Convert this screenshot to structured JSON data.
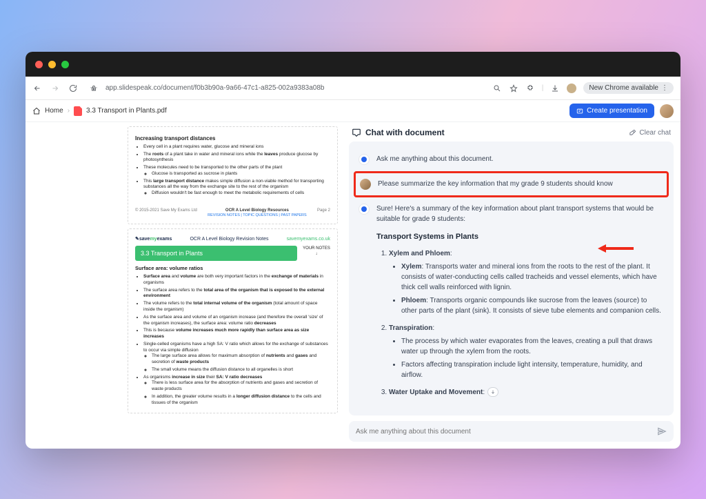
{
  "url": "app.slidespeak.co/document/f0b3b90a-9a66-47c1-a825-002a9383a08b",
  "chrome_badge": "New Chrome available",
  "breadcrumb": {
    "home": "Home",
    "file": "3.3 Transport in Plants.pdf"
  },
  "toolbar": {
    "create": "Create presentation"
  },
  "doc": {
    "page1": {
      "h1": "Increasing transport distances",
      "li1": "Every cell in a plant requires water, glucose and mineral ions",
      "li2a": "The ",
      "li2b": "roots",
      "li2c": " of a plant take in water and mineral ions while the ",
      "li2d": "leaves",
      "li2e": " produce glucose by photosynthesis",
      "li3": "These molecules need to be transported to the other parts of the plant",
      "li3a": "Glucose is transported as sucrose in plants",
      "li4a": "This ",
      "li4b": "large transport distance",
      "li4c": " makes simple diffusion a non-viable method for transporting substances all the way from the exchange site to the rest of the organism",
      "li4s": "Diffusion wouldn't be fast enough to meet the metabolic requirements of cells",
      "footer_left": "© 2015-2021 Save My Exams Ltd",
      "footer_center_title": "OCR A Level Biology Resources",
      "footer_center_links": "REVISION NOTES  |  TOPIC QUESTIONS  |  PAST PAPERS",
      "footer_right": "Page 2"
    },
    "page2": {
      "site_a": "save",
      "site_b": "my",
      "site_c": "exams",
      "site_right": "savemyexams.co.uk",
      "head_title": "OCR A Level Biology Revision Notes",
      "banner": "3.3 Transport in Plants",
      "notes_label": "YOUR NOTES",
      "h_sav": "Surface area: volume ratios",
      "b1a": "Surface area",
      "b1b": " and ",
      "b1c": "volume",
      "b1d": " are both very important factors in the ",
      "b1e": "exchange of materials",
      "b1f": " in organisms",
      "b2a": "The surface area refers to the ",
      "b2b": "total area of the organism that is exposed to the external environment",
      "b3a": "The volume refers to the ",
      "b3b": "total internal volume of the organism",
      "b3c": " (total amount of space inside the organism)",
      "b4": "As the surface area and volume of an organism increase (and therefore the overall 'size' of the organism increases), the surface area: volume ratio ",
      "b4b": "decreases",
      "b5a": "This is because ",
      "b5b": "volume increases much more rapidly than surface area as size increases",
      "b6": "Single-celled organisms have a high SA: V ratio which allows for the exchange of substances to occur via simple diffusion",
      "b6a_a": "The large surface area allows for maximum absorption of ",
      "b6a_b": "nutrients",
      "b6a_c": " and ",
      "b6a_d": "gases",
      "b6a_e": " and secretion of ",
      "b6a_f": "waste products",
      "b6b": "The small volume means the diffusion distance to all organelles is short",
      "b7a": "As organisms ",
      "b7b": "increase in size",
      "b7c": " their ",
      "b7d": "SA: V ratio decreases",
      "b7s1": "There is less surface area for the absorption of nutrients and gases and secretion of waste products",
      "b7s2a": "In addition, the greater volume results in a ",
      "b7s2b": "longer diffusion distance",
      "b7s2c": " to the cells and tissues of the organism"
    }
  },
  "chat": {
    "title": "Chat with document",
    "clear": "Clear chat",
    "m1": "Ask me anything about this document.",
    "m2": "Please summarize the key information that my grade 9 students should know",
    "m3_intro": "Sure! Here's a summary of the key information about plant transport systems that would be suitable for grade 9 students:",
    "h": "Transport Systems in Plants",
    "li1_label": "Xylem and Phloem",
    "li1_a_b": "Xylem",
    "li1_a": ": Transports water and mineral ions from the roots to the rest of the plant. It consists of water-conducting cells called tracheids and vessel elements, which have thick cell walls reinforced with lignin.",
    "li1_b_b": "Phloem",
    "li1_b": ": Transports organic compounds like sucrose from the leaves (source) to other parts of the plant (sink). It consists of sieve tube elements and companion cells.",
    "li2_label": "Transpiration",
    "li2_a": "The process by which water evaporates from the leaves, creating a pull that draws water up through the xylem from the roots.",
    "li2_b": "Factors affecting transpiration include light intensity, temperature, humidity, and airflow.",
    "li3_label": "Water Uptake and Movement",
    "input_placeholder": "Ask me anything about this document"
  }
}
